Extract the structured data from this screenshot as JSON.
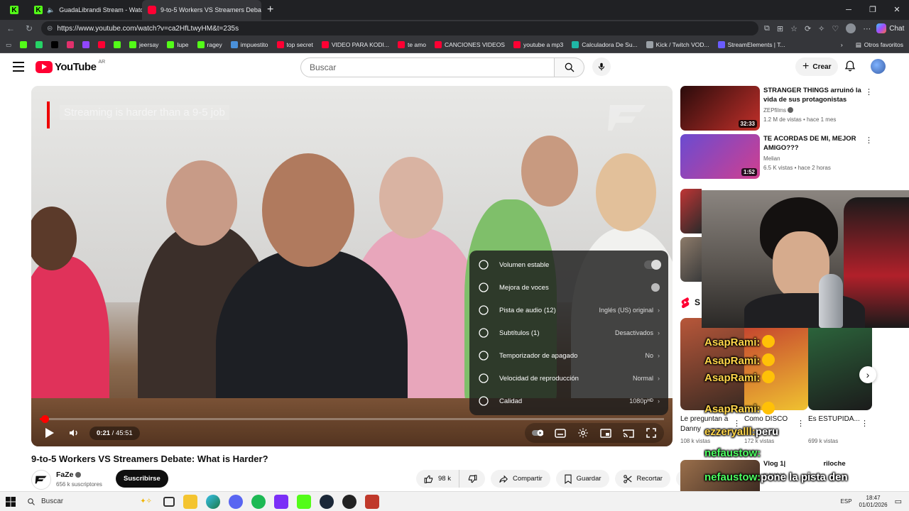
{
  "browser": {
    "tabs": [
      {
        "label": "GuadaLibrandi Stream - Watc",
        "active": false
      },
      {
        "label": "9-to-5 Workers VS Streamers Deba",
        "active": true
      }
    ],
    "url": "https://www.youtube.com/watch?v=ca2HfLtwyHM&t=235s",
    "chat_label": "Chat",
    "bookmarks": [
      {
        "label": "",
        "color": "#53fc18"
      },
      {
        "label": "",
        "color": "#25d366"
      },
      {
        "label": "",
        "color": "#000000"
      },
      {
        "label": "",
        "color": "#e1306c"
      },
      {
        "label": "",
        "color": "#9146ff"
      },
      {
        "label": "",
        "color": "#ff0033"
      },
      {
        "label": "",
        "color": "#53fc18"
      },
      {
        "label": "jeersay",
        "color": "#53fc18"
      },
      {
        "label": "lupe",
        "color": "#53fc18"
      },
      {
        "label": "ragey",
        "color": "#53fc18"
      },
      {
        "label": "impuestito",
        "color": "#4a90d9"
      },
      {
        "label": "top secret",
        "color": "#ff0033"
      },
      {
        "label": "VIDEO PARA KODI...",
        "color": "#ff0033"
      },
      {
        "label": "te amo",
        "color": "#ff0033"
      },
      {
        "label": "CANCIONES VIDEOS",
        "color": "#ff0033"
      },
      {
        "label": "youtube a mp3",
        "color": "#ff0033"
      },
      {
        "label": "Calculadora De Su...",
        "color": "#1fb6a6"
      },
      {
        "label": "Kick / Twitch VOD...",
        "color": "#9aa0a6"
      },
      {
        "label": "StreamElements | T...",
        "color": "#6a5cff"
      }
    ],
    "others_label": "Otros favoritos"
  },
  "youtube": {
    "logo_text": "YouTube",
    "country": "AR",
    "search_placeholder": "Buscar",
    "create_label": "Crear"
  },
  "player": {
    "caption": "Streaming is harder than a 9-5 job",
    "time_current": "0:21",
    "time_total": "45:51",
    "progress_fraction": 0.0076,
    "settings": [
      {
        "icon": "stable-volume-icon",
        "label": "Volumen estable",
        "value": "",
        "control": "toggle"
      },
      {
        "icon": "voice-boost-icon",
        "label": "Mejora de voces",
        "value": "",
        "control": "dot"
      },
      {
        "icon": "audio-track-icon",
        "label": "Pista de audio (12)",
        "value": "Inglés (US) original",
        "control": "chevron"
      },
      {
        "icon": "subtitles-icon",
        "label": "Subtítulos (1)",
        "value": "Desactivados",
        "control": "chevron"
      },
      {
        "icon": "sleep-timer-icon",
        "label": "Temporizador de apagado",
        "value": "No",
        "control": "chevron"
      },
      {
        "icon": "playback-speed-icon",
        "label": "Velocidad de reproducción",
        "value": "Normal",
        "control": "chevron"
      },
      {
        "icon": "quality-icon",
        "label": "Calidad",
        "value": "1080p",
        "badge": "HD",
        "control": "chevron"
      }
    ]
  },
  "video": {
    "title": "9-to-5 Workers VS Streamers Debate: What is Harder?",
    "channel": "FaZe",
    "subscribers": "656 k suscriptores",
    "subscribe_label": "Suscribirse",
    "likes": "98 k",
    "share_label": "Compartir",
    "save_label": "Guardar",
    "clip_label": "Recortar"
  },
  "sidebar": {
    "recommended": [
      {
        "title": "STRANGER THINGS arruinó la vida de sus protagonistas",
        "channel": "ZEPfilms",
        "meta": "1.2 M de vistas • hace 1 mes",
        "duration": "32:33",
        "colors": [
          "#2a0b0b",
          "#c2302a"
        ]
      },
      {
        "title": "TE ACORDAS DE MI, MEJOR AMIGO???",
        "channel": "Melian",
        "meta": "6.5 K vistas • hace 2 horas",
        "duration": "1:52",
        "colors": [
          "#6a4bd1",
          "#d13f8f"
        ]
      }
    ],
    "shorts_label": "S",
    "shorts": [
      {
        "title": "Le preguntan a Danny",
        "views": "108 k vistas",
        "colors": [
          "#b8573a",
          "#3a2a22"
        ]
      },
      {
        "title": "Como DISCO",
        "views": "172 k vistas",
        "colors": [
          "#c23b2f",
          "#f0c230"
        ]
      },
      {
        "title": "Es ESTUPIDA...",
        "views": "699 k vistas",
        "colors": [
          "#2d6a3e",
          "#1b1b1b"
        ]
      }
    ],
    "bottom_item": {
      "title": "Vlog 1|",
      "title_tail": "riloche",
      "channel": "marcoos"
    }
  },
  "stream_chat": [
    {
      "user": "AsapRami:",
      "text": "",
      "style": "u1"
    },
    {
      "user": "AsapRami:",
      "text": "",
      "style": "u1"
    },
    {
      "user": "AsapRami:",
      "text": "",
      "style": "u1"
    },
    {
      "user": "AsapRami:",
      "text": "",
      "style": "u1"
    },
    {
      "user": "ezzeryalll:",
      "text": "peru",
      "style": "u1"
    },
    {
      "user": "nefaustow:",
      "text": "",
      "style": "u2"
    },
    {
      "user": "nefaustow:",
      "text": "pone la pista den",
      "style": "u2"
    },
    {
      "user": "",
      "text": "español",
      "style": "u2"
    }
  ],
  "taskbar": {
    "search_label": "Buscar",
    "language": "ESP",
    "time": "18:47",
    "date": "01/01/2026"
  }
}
